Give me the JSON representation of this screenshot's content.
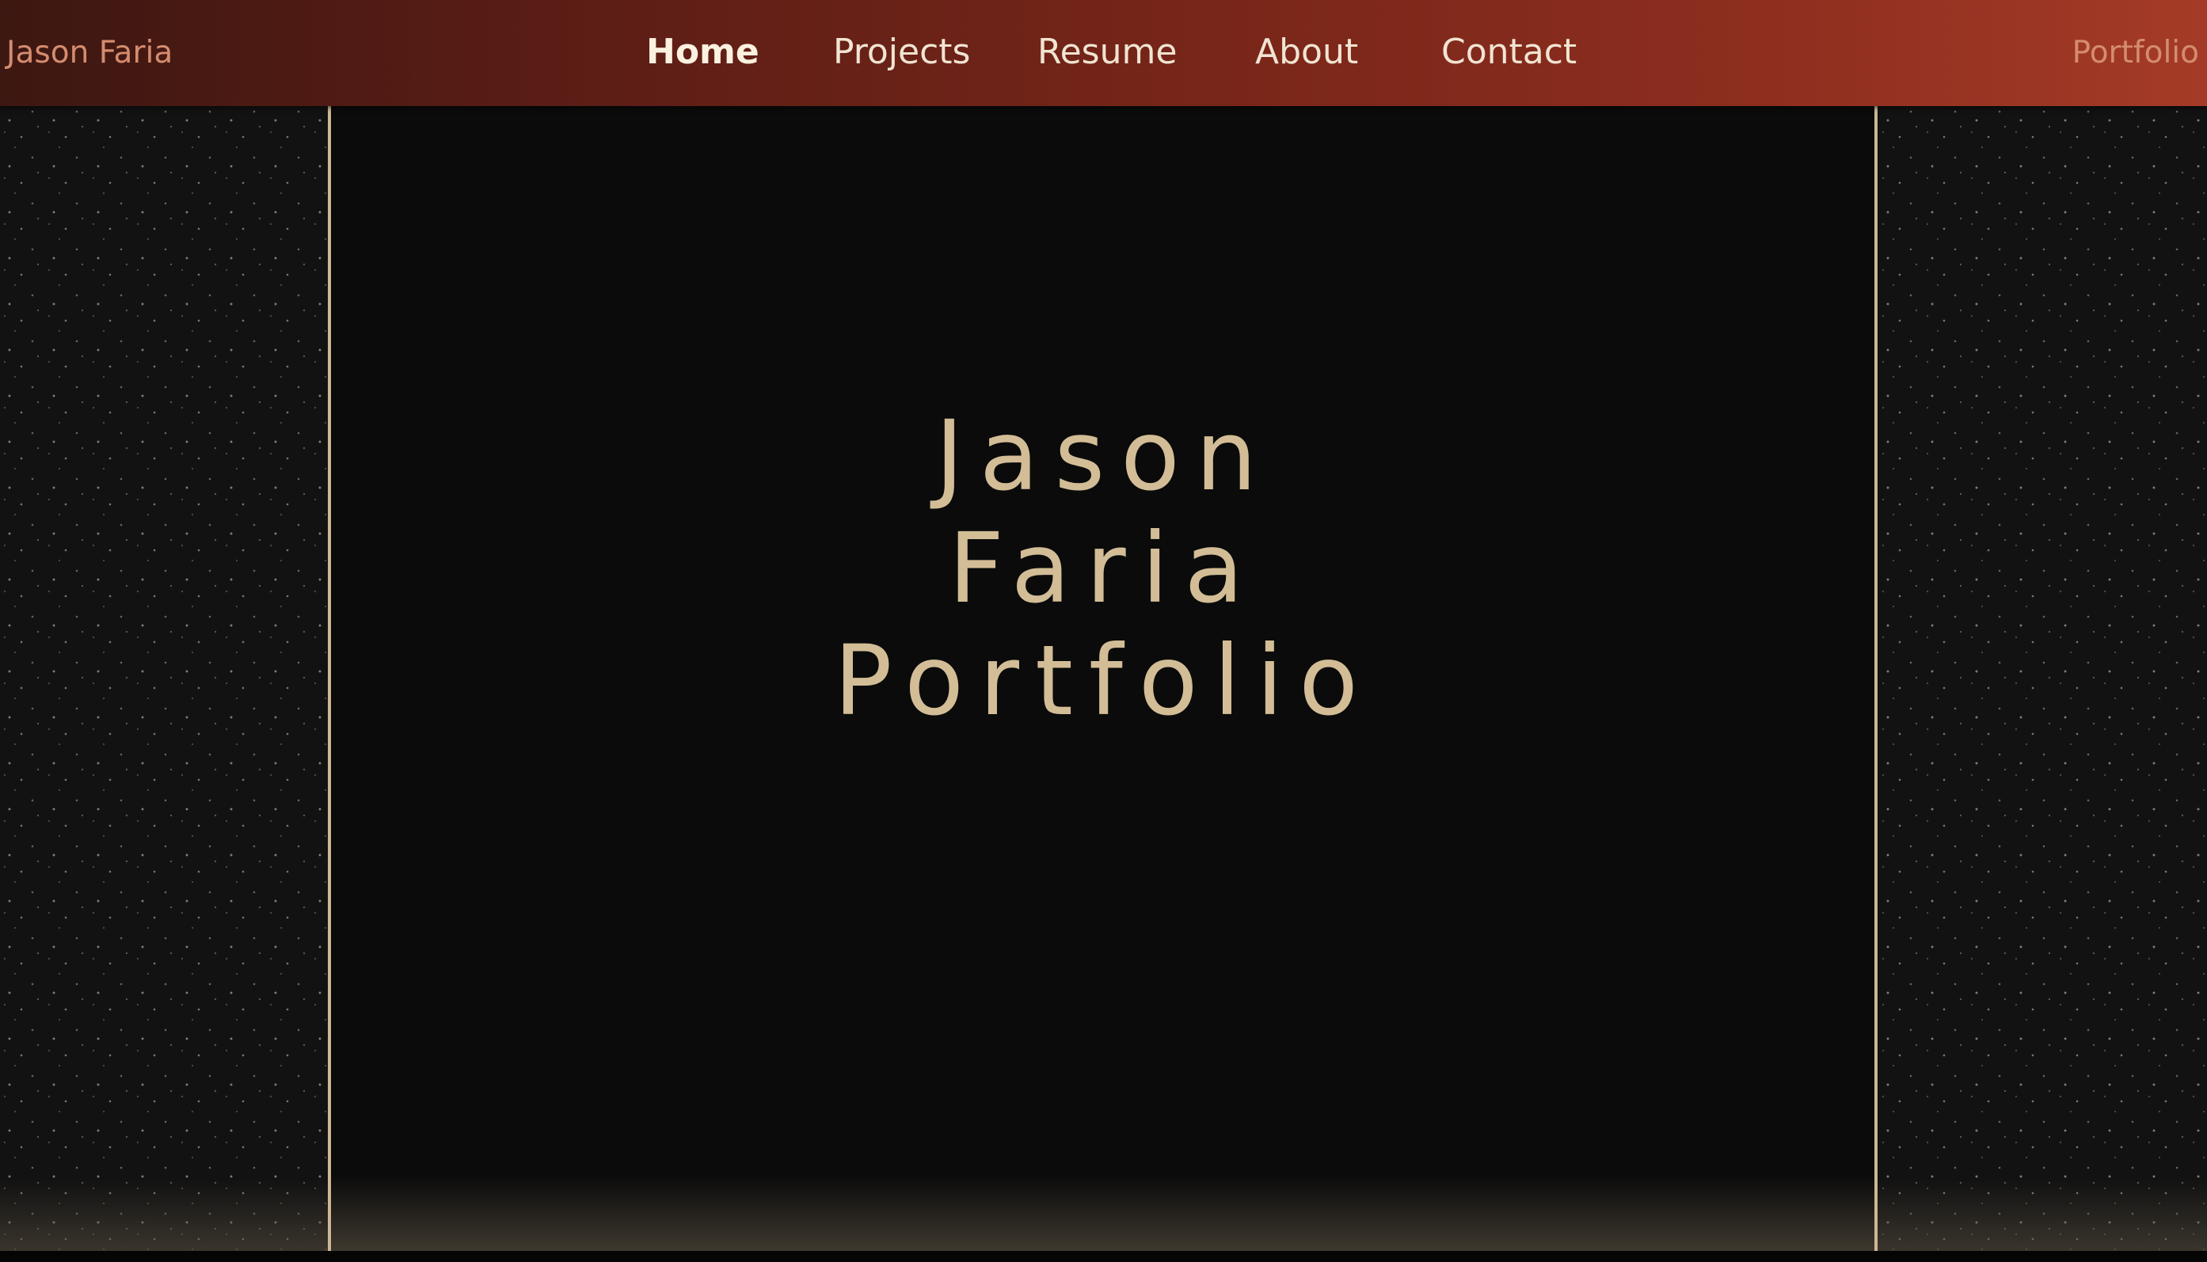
{
  "header": {
    "brand_left": "Jason Faria",
    "brand_right": "Portfolio",
    "nav": [
      {
        "label": "Home",
        "active": true
      },
      {
        "label": "Projects",
        "active": false
      },
      {
        "label": "Resume",
        "active": false
      },
      {
        "label": "About",
        "active": false
      },
      {
        "label": "Contact",
        "active": false
      }
    ]
  },
  "hero": {
    "lines": [
      "Jason",
      "Faria",
      "Portfolio"
    ]
  },
  "colors": {
    "header_gradient_start": "#3d1711",
    "header_gradient_end": "#a43b27",
    "accent_text": "#d3bd96",
    "brand_text": "#d48c6f",
    "background": "#0b0b0b",
    "divider": "#cdb894"
  }
}
